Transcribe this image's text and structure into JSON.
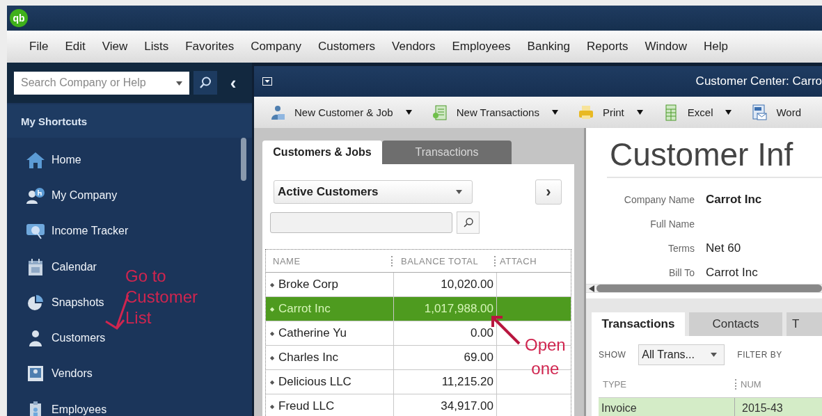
{
  "app": {
    "logo": "qb"
  },
  "menu": [
    "File",
    "Edit",
    "View",
    "Lists",
    "Favorites",
    "Company",
    "Customers",
    "Vendors",
    "Employees",
    "Banking",
    "Reports",
    "Window",
    "Help"
  ],
  "sidebar": {
    "search": {
      "placeholder": "Search Company or Help"
    },
    "collapse": "‹",
    "header": "My Shortcuts",
    "items": [
      {
        "label": "Home",
        "kind": "home"
      },
      {
        "label": "My Company",
        "kind": "company"
      },
      {
        "label": "Income Tracker",
        "kind": "tracker"
      },
      {
        "label": "Calendar",
        "kind": "calendar"
      },
      {
        "label": "Snapshots",
        "kind": "snapshots"
      },
      {
        "label": "Customers",
        "kind": "person"
      },
      {
        "label": "Vendors",
        "kind": "vendor"
      },
      {
        "label": "Employees",
        "kind": "employee"
      }
    ]
  },
  "window": {
    "title": "Customer Center: Carro"
  },
  "toolbar": [
    {
      "label": "New Customer & Job",
      "kind": "customer",
      "dropdown": true
    },
    {
      "label": "New Transactions",
      "kind": "transactions",
      "dropdown": true
    },
    {
      "label": "Print",
      "kind": "print",
      "dropdown": true
    },
    {
      "label": "Excel",
      "kind": "excel",
      "dropdown": true
    },
    {
      "label": "Word",
      "kind": "word",
      "dropdown": false
    }
  ],
  "list_panel": {
    "tabs": [
      {
        "label": "Customers & Jobs",
        "selected": true
      },
      {
        "label": "Transactions",
        "selected": false
      }
    ],
    "filter": "Active Customers",
    "next": "›",
    "columns": [
      "NAME",
      "BALANCE TOTAL",
      "ATTACH"
    ],
    "rows": [
      {
        "marker": "◆",
        "name": "Broke Corp",
        "balance": "10,020.00",
        "selected": false
      },
      {
        "marker": "◆",
        "name": "Carrot Inc",
        "balance": "1,017,988.00",
        "selected": true
      },
      {
        "marker": "◆",
        "name": "Catherine Yu",
        "balance": "0.00",
        "selected": false
      },
      {
        "marker": "◆",
        "name": "Charles Inc",
        "balance": "69.00",
        "selected": false
      },
      {
        "marker": "◆",
        "name": "Delicious LLC",
        "balance": "11,215.20",
        "selected": false
      },
      {
        "marker": "◆",
        "name": "Freud LLC",
        "balance": "34,917.00",
        "selected": false
      }
    ]
  },
  "info": {
    "title": "Customer Inf",
    "fields": [
      {
        "label": "Company Name",
        "value": "Carrot Inc",
        "bold": true
      },
      {
        "label": "Full Name"
      },
      {
        "label": "Terms",
        "value": "Net 60",
        "bold": false
      },
      {
        "label": "Bill To",
        "value": "Carrot Inc",
        "bold": false
      }
    ]
  },
  "details": {
    "tabs": [
      {
        "label": "Transactions",
        "selected": true
      },
      {
        "label": "Contacts",
        "selected": false
      },
      {
        "label": "T",
        "selected": false
      }
    ],
    "show_label": "SHOW",
    "show_value": "All Trans...",
    "filter_label": "FILTER BY",
    "columns": [
      "TYPE",
      "NUM"
    ],
    "rows": [
      {
        "type": "Invoice",
        "num": "2015-43",
        "selected": true
      }
    ]
  },
  "annotations": [
    {
      "lines": [
        "Go to",
        "Customer",
        "List"
      ]
    },
    {
      "lines": [
        "Open",
        "one"
      ]
    }
  ]
}
